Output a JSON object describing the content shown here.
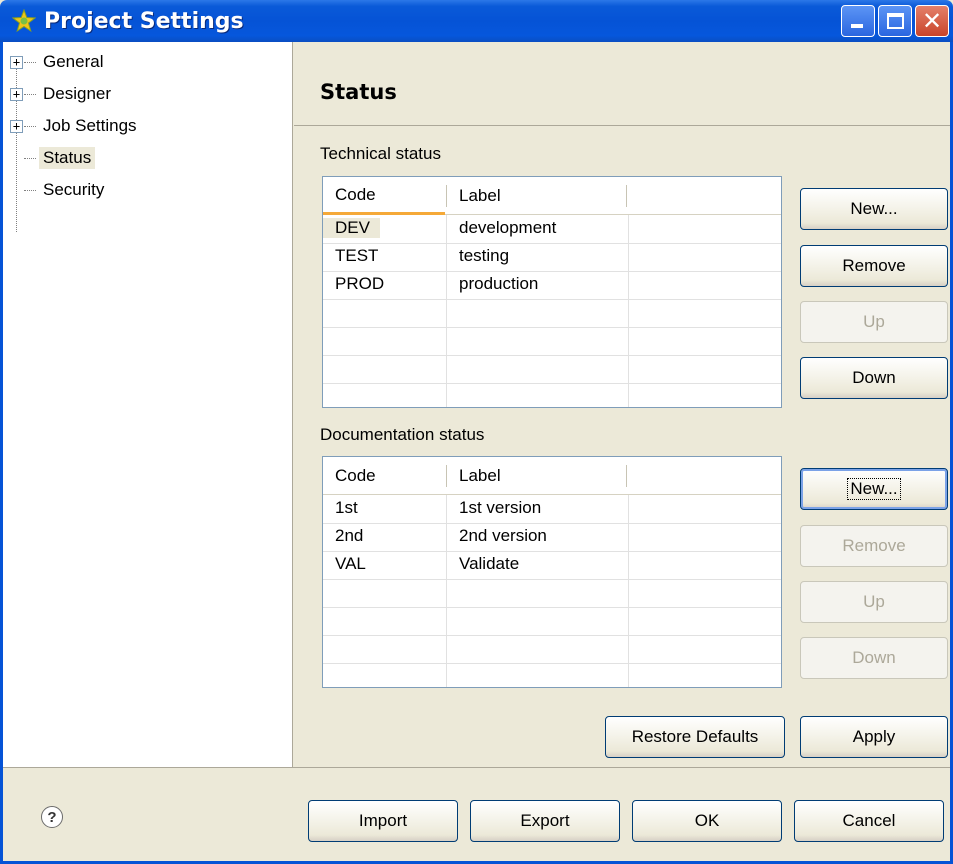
{
  "window": {
    "title": "Project Settings",
    "controls": {
      "minimize": "minimize",
      "maximize": "maximize",
      "close": "✕"
    }
  },
  "tree": {
    "items": [
      {
        "label": "General",
        "expandable": true
      },
      {
        "label": "Designer",
        "expandable": true
      },
      {
        "label": "Job Settings",
        "expandable": true
      },
      {
        "label": "Status",
        "expandable": false,
        "selected": true
      },
      {
        "label": "Security",
        "expandable": false
      }
    ]
  },
  "panel": {
    "title": "Status",
    "technical": {
      "label": "Technical status",
      "columns": [
        "Code",
        "Label"
      ],
      "rows": [
        {
          "code": "DEV",
          "label": "development"
        },
        {
          "code": "TEST",
          "label": "testing"
        },
        {
          "code": "PROD",
          "label": "production"
        }
      ],
      "buttons": {
        "new": "New...",
        "remove": "Remove",
        "up": "Up",
        "down": "Down"
      }
    },
    "documentation": {
      "label": "Documentation status",
      "columns": [
        "Code",
        "Label"
      ],
      "rows": [
        {
          "code": "1st",
          "label": "1st version"
        },
        {
          "code": "2nd",
          "label": "2nd version"
        },
        {
          "code": "VAL",
          "label": "Validate"
        }
      ],
      "buttons": {
        "new": "New...",
        "remove": "Remove",
        "up": "Up",
        "down": "Down"
      }
    },
    "restore_defaults": "Restore Defaults",
    "apply": "Apply"
  },
  "footer": {
    "help_icon": "?",
    "import": "Import",
    "export": "Export",
    "ok": "OK",
    "cancel": "Cancel"
  },
  "colors": {
    "titlebar": "#0553d6",
    "window_bg": "#ece9d8",
    "sort_indicator": "#f5a938"
  }
}
